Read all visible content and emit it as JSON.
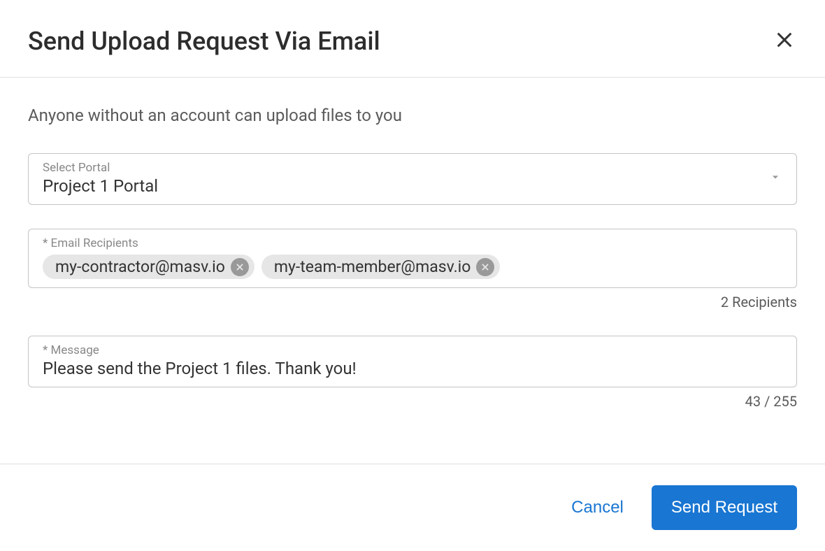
{
  "header": {
    "title": "Send Upload Request Via Email"
  },
  "content": {
    "subtitle": "Anyone without an account can upload files to you",
    "portal": {
      "label": "Select Portal",
      "value": "Project 1 Portal"
    },
    "recipients": {
      "label": "* Email Recipients",
      "chips": [
        "my-contractor@masv.io",
        "my-team-member@masv.io"
      ],
      "counter": "2 Recipients"
    },
    "message": {
      "label": "* Message",
      "value": "Please send the Project 1 files. Thank you!",
      "counter": "43 / 255"
    }
  },
  "footer": {
    "cancel": "Cancel",
    "send": "Send Request"
  }
}
